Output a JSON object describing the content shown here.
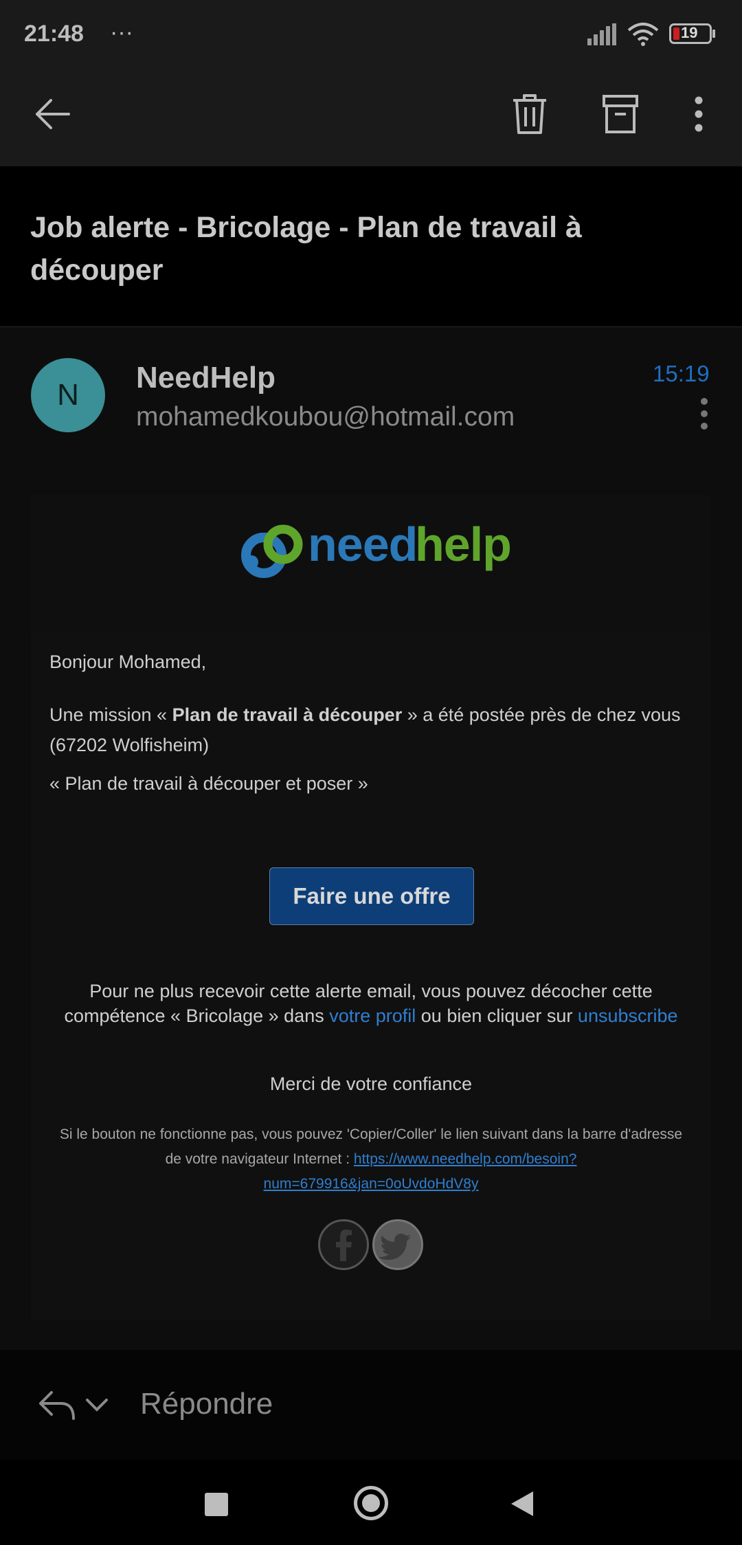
{
  "status_bar": {
    "time": "21:48",
    "dots": "···",
    "battery_level": "19"
  },
  "toolbar": {
    "back_icon": "arrow-left-icon",
    "delete_icon": "trash-icon",
    "archive_icon": "archive-icon",
    "more_icon": "more-vertical-icon"
  },
  "email": {
    "subject_line1": "Job alerte - Bricolage - Plan de travail à",
    "subject_line2": "découper",
    "sender": {
      "avatar_letter": "N",
      "name": "NeedHelp",
      "address": "mohamedkoubou@hotmail.com",
      "time": "15:19"
    },
    "logo": {
      "part1": "need",
      "part2": "help"
    },
    "body": {
      "greeting": "Bonjour Mohamed,",
      "mission_prefix": "Une mission « ",
      "mission_title": "Plan de travail à découper",
      "mission_suffix_line1": " » a été postée près de chez vous",
      "mission_line2": "(67202 Wolfisheim)",
      "quote": "« Plan de travail à découper et poser »",
      "offer_button": "Faire une offre",
      "unsubscribe_line1": "Pour ne plus recevoir cette alerte email, vous pouvez décocher cette",
      "unsubscribe_line2_a": "compétence « Bricolage » dans ",
      "profile_link": "votre profil",
      "unsubscribe_line2_b": " ou bien cliquer sur ",
      "unsubscribe_link": "unsubscribe",
      "thanks": "Merci de votre confiance",
      "fallback_line1": "Si le bouton ne fonctionne pas, vous pouvez 'Copier/Coller' le lien suivant dans la barre d'adresse",
      "fallback_line2_prefix": "de votre navigateur Internet : ",
      "fallback_url_part1": "https://www.needhelp.com/besoin?",
      "fallback_url_part2": "num=679916&jan=0oUvdoHdV8y"
    },
    "social": [
      "facebook-icon",
      "twitter-icon"
    ]
  },
  "reply": {
    "label": "Répondre"
  },
  "colors": {
    "accent_blue": "#2f7fd0",
    "button_blue": "#0d3e78",
    "avatar_teal": "#3b8f96",
    "logo_blue": "#2a78b8",
    "logo_green": "#5fa52c"
  }
}
